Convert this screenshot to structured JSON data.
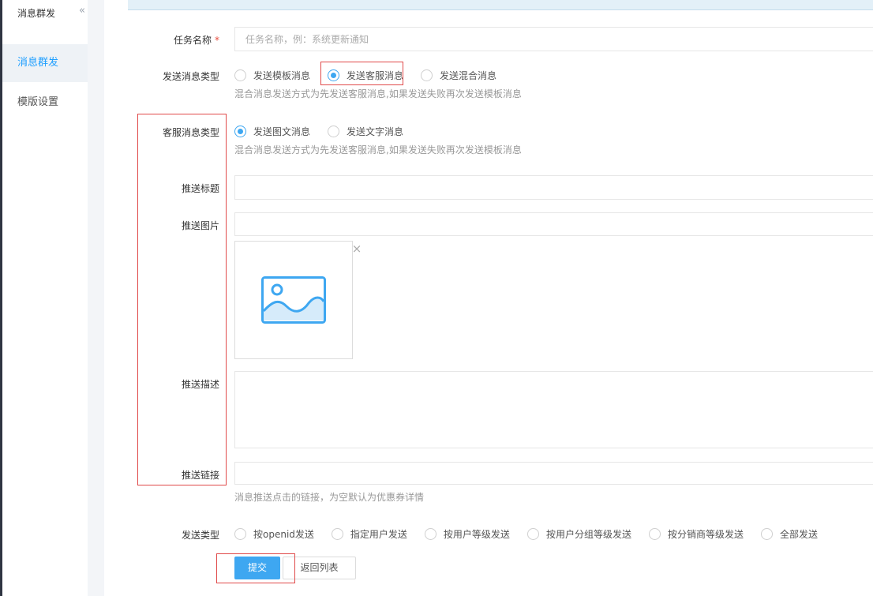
{
  "sidebar": {
    "title": "消息群发",
    "collapse_icon": "«",
    "items": [
      {
        "label": "消息群发",
        "active": true
      },
      {
        "label": "模版设置",
        "active": false
      }
    ]
  },
  "form": {
    "task_name": {
      "label": "任务名称",
      "required_mark": "*",
      "placeholder": "任务名称，例：系统更新通知",
      "value": ""
    },
    "send_type": {
      "label": "发送消息类型",
      "options": [
        "发送模板消息",
        "发送客服消息",
        "发送混合消息"
      ],
      "selected": "发送客服消息",
      "hint": "混合消息发送方式为先发送客服消息,如果发送失败再次发送模板消息"
    },
    "kefu_type": {
      "label": "客服消息类型",
      "options": [
        "发送图文消息",
        "发送文字消息"
      ],
      "selected": "发送图文消息",
      "hint": "混合消息发送方式为先发送客服消息,如果发送失败再次发送模板消息"
    },
    "push_title": {
      "label": "推送标题",
      "value": ""
    },
    "push_image": {
      "label": "推送图片",
      "value": "",
      "delete_icon": "×"
    },
    "push_desc": {
      "label": "推送描述",
      "value": ""
    },
    "push_link": {
      "label": "推送链接",
      "value": "",
      "hint": "消息推送点击的链接，为空默认为优惠券详情"
    },
    "target_type": {
      "label": "发送类型",
      "options": [
        "按openid发送",
        "指定用户发送",
        "按用户等级发送",
        "按用户分组等级发送",
        "按分销商等级发送",
        "全部发送"
      ],
      "selected": ""
    },
    "submit_label": "提交",
    "back_label": "返回列表"
  },
  "colors": {
    "accent": "#3ea7f1",
    "highlight": "#e04a4a",
    "sidebar_active": "#1e9fff"
  }
}
